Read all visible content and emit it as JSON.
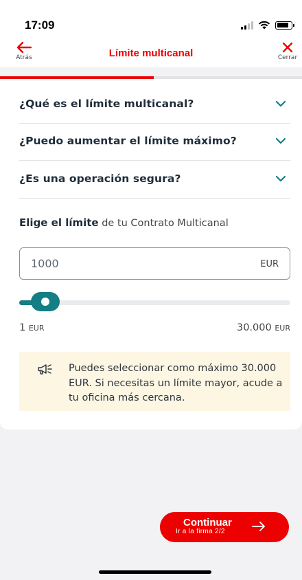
{
  "status_bar": {
    "time": "17:09"
  },
  "nav": {
    "back_label": "Atrás",
    "title": "Límite multicanal",
    "close_label": "Cerrar"
  },
  "progress": {
    "fraction": 0.51
  },
  "faq": [
    {
      "question": "¿Qué es el límite multicanal?"
    },
    {
      "question": "¿Puedo aumentar el límite máximo?"
    },
    {
      "question": "¿Es una operación segura?"
    }
  ],
  "limit": {
    "prompt_bold": "Elige el límite",
    "prompt_rest": " de tu Contrato Multicanal",
    "amount": "1000",
    "currency": "EUR",
    "slider_value": 1000,
    "min_value": "1",
    "max_value": "30.000",
    "unit": "EUR"
  },
  "notice": {
    "text": "Puedes seleccionar como máximo 30.000 EUR. Si necesitas un límite mayor, acude a tu oficina más cercana."
  },
  "cta": {
    "label": "Continuar",
    "sublabel": "Ir a la firma 2/2"
  },
  "colors": {
    "brand_red": "#ec0000",
    "teal": "#137e84",
    "notice_bg": "#fdf6e3"
  }
}
